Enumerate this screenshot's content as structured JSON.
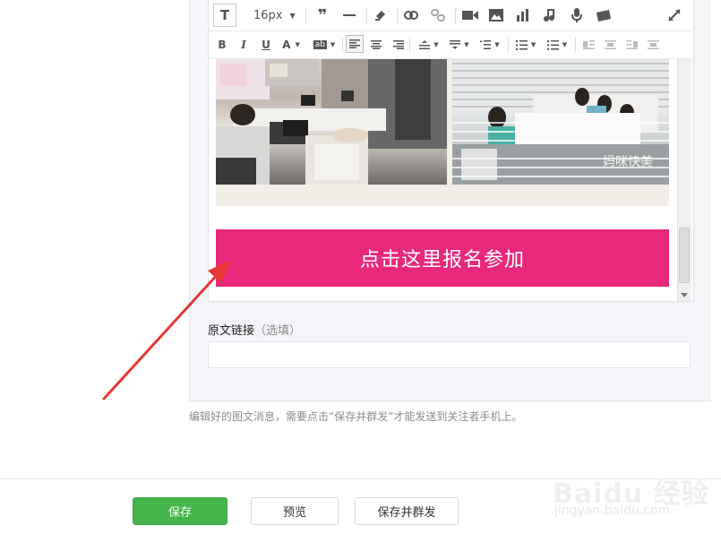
{
  "toolbar": {
    "font_size": "16px"
  },
  "content": {
    "photo_watermark": "妈咪快美",
    "signup_button": "点击这里报名参加"
  },
  "original_link": {
    "label": "原文链接",
    "optional": "（选填）",
    "value": ""
  },
  "hint_text": "编辑好的图文消息，需要点击“保存并群发”才能发送到关注者手机上。",
  "footer": {
    "save_label": "保存",
    "preview_label": "预览",
    "publish_label": "保存并群发"
  },
  "watermark": {
    "brand": "Baidu 经验",
    "url": "jingyan.baidu.com"
  },
  "colors": {
    "signup_button": "#e8297b",
    "save_button": "#44b549",
    "arrow": "#e53935"
  }
}
